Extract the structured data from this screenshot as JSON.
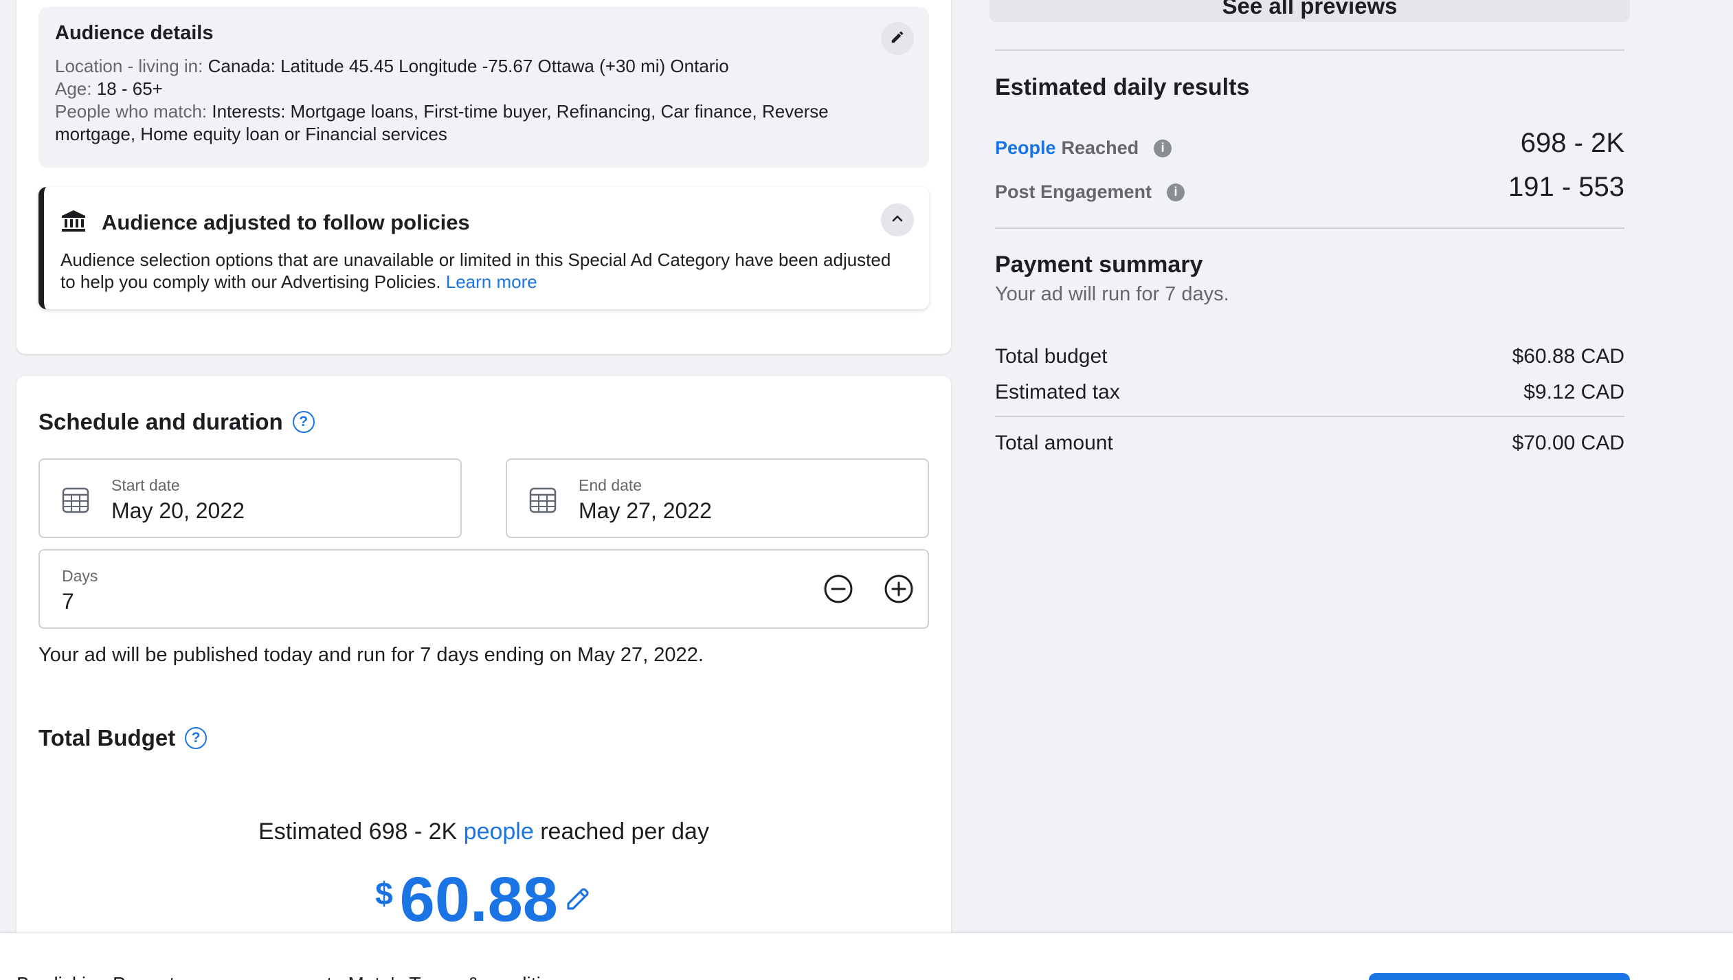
{
  "audience": {
    "title": "Audience details",
    "location_label": "Location - living in:",
    "location_value": "Canada: Latitude 45.45 Longitude -75.67 Ottawa (+30 mi) Ontario",
    "age_label": "Age:",
    "age_value": "18 - 65+",
    "match_label": "People who match:",
    "match_value": "Interests: Mortgage loans, First-time buyer, Refinancing, Car finance, Reverse mortgage, Home equity loan or Financial services",
    "edit_icon": "pencil-icon"
  },
  "policy": {
    "title": "Audience adjusted to follow policies",
    "text": "Audience selection options that are unavailable or limited in this Special Ad Category have been adjusted to help you comply with our Advertising Policies.",
    "link": "Learn more",
    "icon": "bank-icon"
  },
  "schedule": {
    "title": "Schedule and duration",
    "start_label": "Start date",
    "start_value": "May 20, 2022",
    "end_label": "End date",
    "end_value": "May 27, 2022",
    "days_label": "Days",
    "days_value": "7",
    "publish_text": "Your ad will be published today and run for 7 days ending on May 27, 2022."
  },
  "budget": {
    "title": "Total Budget",
    "est_prefix": "Estimated 698 - 2K",
    "est_link": "people",
    "est_suffix": "reached per day",
    "currency": "$",
    "amount": "60.88"
  },
  "previews": {
    "button_label": "See all previews"
  },
  "results": {
    "title": "Estimated daily results",
    "people_link": "People",
    "people_label": "Reached",
    "people_value": "698 - 2K",
    "engagement_label": "Post Engagement",
    "engagement_value": "191 - 553"
  },
  "payment": {
    "title": "Payment summary",
    "subtitle": "Your ad will run for 7 days.",
    "total_budget_label": "Total budget",
    "total_budget_value": "$60.88 CAD",
    "tax_label": "Estimated tax",
    "tax_value": "$9.12 CAD",
    "total_label": "Total amount",
    "total_value": "$70.00 CAD"
  },
  "footer": {
    "text": "By clicking Promote now, you agree to Meta's Terms & conditions"
  },
  "colors": {
    "accent": "#1b74e4",
    "background": "#f0f2f5",
    "card": "#ffffff",
    "muted_text": "#65676b"
  }
}
